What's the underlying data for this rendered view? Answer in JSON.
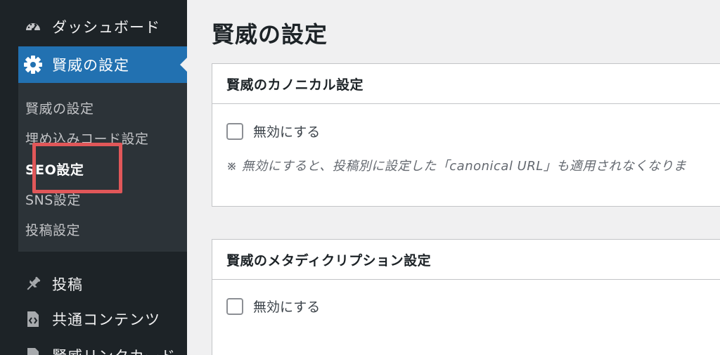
{
  "sidebar": {
    "items": [
      {
        "label": "ダッシュボード",
        "icon": "dashboard-icon"
      },
      {
        "label": "賢威の設定",
        "icon": "gear-icon",
        "active": true
      },
      {
        "label": "投稿",
        "icon": "pin-icon"
      },
      {
        "label": "共通コンテンツ",
        "icon": "code-file-icon"
      },
      {
        "label": "賢威リンクカード",
        "icon": "document-icon"
      }
    ],
    "submenu": [
      {
        "label": "賢威の設定"
      },
      {
        "label": "埋め込みコード設定"
      },
      {
        "label": "SEO設定",
        "current": true
      },
      {
        "label": "SNS設定"
      },
      {
        "label": "投稿設定"
      }
    ],
    "colors": {
      "background": "#1d2327",
      "active": "#2271b1",
      "submenu_bg": "#2c3338",
      "highlight": "#e15759"
    }
  },
  "main": {
    "title": "賢威の設定",
    "panels": [
      {
        "heading": "賢威のカノニカル設定",
        "checkbox_label": "無効にする",
        "checked": false,
        "note": "※ 無効にすると、投稿別に設定した「canonical URL」も適用されなくなりま"
      },
      {
        "heading": "賢威のメタディクリプション設定",
        "checkbox_label": "無効にする",
        "checked": false
      }
    ]
  }
}
